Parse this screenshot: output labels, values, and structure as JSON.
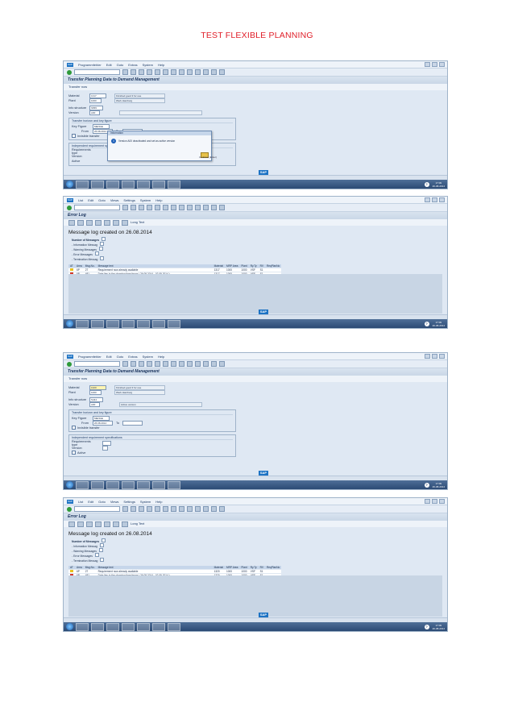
{
  "document": {
    "title": "TEST FLEXIBLE PLANNING"
  },
  "screens": [
    {
      "type": "transfer-form",
      "menu": [
        "Programmfehler",
        "Edit",
        "Goto",
        "Extras",
        "System",
        "Help"
      ],
      "title": "Transfer Planning Data to Demand Management",
      "app_button": "Transfer now",
      "fields": [
        {
          "label": "Material",
          "value": "1317",
          "desc": "Finished good 3 for use"
        },
        {
          "label": "Plant",
          "value": "1000",
          "desc": "Werk Hamburg"
        },
        {
          "label": "Info structure",
          "value": "S555",
          "desc": ""
        },
        {
          "label": "Version",
          "value": "A00",
          "desc": ""
        }
      ],
      "group1": {
        "title": "Transfer horizon and key figure",
        "rows": [
          {
            "label": "Key Figure",
            "value": "MENGE"
          },
          {
            "label": "From",
            "value": "26.08.2014",
            "to_label": "To",
            "to_value": ""
          }
        ],
        "checkbox": "Invisible transfer"
      },
      "group2": {
        "title": "Independent requirement specifications",
        "rows": [
          "Requirements type",
          "Version",
          "Active"
        ]
      },
      "popup": {
        "title": "Information",
        "message": "Version A00 deactivated and set as active version",
        "button_hint": "Continue (Enter)"
      }
    },
    {
      "type": "error-log",
      "menu": [
        "List",
        "Edit",
        "Goto",
        "Views",
        "Settings",
        "System",
        "Help"
      ],
      "title": "Error Log",
      "app_button": "Long Text",
      "heading": "Message log created on 26.08.2014",
      "summary": [
        "Number of Messages",
        "- Information Messag",
        "- Warning Messages",
        "- Error Messages",
        "- Termination Messag"
      ],
      "columns": [
        "AT",
        "Area",
        "Msg.No.",
        "Message text",
        "Material",
        "MRP Area",
        "Plant",
        "Ry.Ty",
        "RV",
        "ReqPlanNo"
      ],
      "rows": [
        {
          "status": "yellow",
          "area": "6P",
          "no": "27",
          "text": "Requirement now already available",
          "material": "1317",
          "mrp": "1000",
          "plant": "1000",
          "rt": "VSF",
          "rv": "S1",
          "req": ""
        },
        {
          "status": "red",
          "area": "6P",
          "no": "481",
          "text": "Date lies in the planning time fence ( 26.08.2014 - 02.09.2014 )",
          "material": "1317",
          "mrp": "1000",
          "plant": "1000",
          "rt": "VSF",
          "rv": "S1",
          "req": ""
        }
      ]
    },
    {
      "type": "transfer-form",
      "menu": [
        "Programmfehler",
        "Edit",
        "Goto",
        "Extras",
        "System",
        "Help"
      ],
      "title": "Transfer Planning Data to Demand Management",
      "app_button": "Transfer now",
      "fields": [
        {
          "label": "Material",
          "value": "1320",
          "desc": "Finished good 3 for use"
        },
        {
          "label": "Plant",
          "value": "1000",
          "desc": "Werk Hamburg"
        },
        {
          "label": "Info structure",
          "value": "S444",
          "desc": ""
        },
        {
          "label": "Version",
          "value": "A00",
          "desc": "Active version"
        }
      ],
      "group1": {
        "title": "Transfer horizon and key figure",
        "rows": [
          {
            "label": "Key Figure",
            "value": "MENGE"
          },
          {
            "label": "From",
            "value": "26.08.2014",
            "to_label": "To",
            "to_value": ""
          }
        ],
        "checkbox": "Invisible transfer"
      },
      "group2": {
        "title": "Independent requirement specifications",
        "rows": [
          "Requirements type",
          "Version",
          "Active"
        ]
      }
    },
    {
      "type": "error-log",
      "menu": [
        "List",
        "Edit",
        "Goto",
        "Views",
        "Settings",
        "System",
        "Help"
      ],
      "title": "Error Log",
      "app_button": "Long Text",
      "heading": "Message log created on 26.08.2014",
      "summary": [
        "Number of Messages",
        "- Information Messag",
        "- Warning Messages",
        "- Error Messages",
        "- Termination Messag"
      ],
      "columns": [
        "AT",
        "Area",
        "Msg.No.",
        "Message text",
        "Material",
        "MRP Area",
        "Plant",
        "Ry.Ty",
        "RV",
        "ReqPlanNo"
      ],
      "rows": [
        {
          "status": "yellow",
          "area": "6P",
          "no": "27",
          "text": "Requirement now already available",
          "material": "1320",
          "mrp": "1000",
          "plant": "1000",
          "rt": "VSF",
          "rv": "S1",
          "req": ""
        },
        {
          "status": "red",
          "area": "6P",
          "no": "481",
          "text": "Date lies in the planning time fence ( 26.08.2014 - 02.09.2014 )",
          "material": "1320",
          "mrp": "1000",
          "plant": "1000",
          "rt": "VSF",
          "rv": "S1",
          "req": ""
        }
      ]
    }
  ],
  "taskbar": {
    "time": "17:09",
    "date": "26-08-2014",
    "status": "SAP"
  }
}
